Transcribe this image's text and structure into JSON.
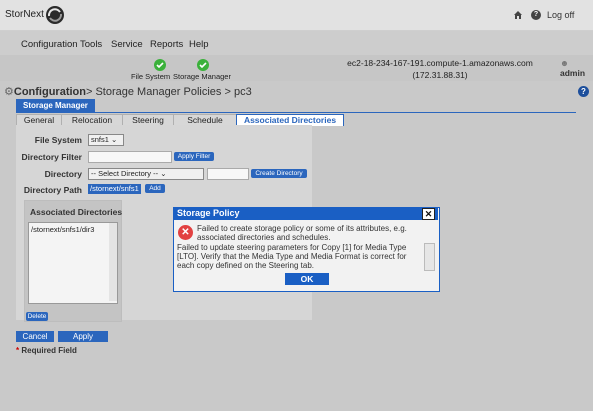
{
  "app": {
    "name": "StorNext",
    "logout_label": "Log off"
  },
  "menu": [
    "Configuration",
    "Tools",
    "Service",
    "Reports",
    "Help"
  ],
  "status": {
    "file_system_label": "File System",
    "storage_manager_label": "Storage Manager",
    "host_name": "ec2-18-234-167-191.compute-1.amazonaws.com",
    "host_ip": "(172.31.88.31)",
    "user": "admin"
  },
  "breadcrumb": {
    "section": "Configuration",
    "path": "> Storage Manager Policies > pc3"
  },
  "section_tab": "Storage Manager",
  "tabs": [
    "General",
    "Relocation",
    "Steering",
    "Schedule",
    "Associated Directories"
  ],
  "form": {
    "file_system_label": "File System",
    "file_system_value": "snfs1",
    "directory_filter_label": "Directory Filter",
    "apply_filter_label": "Apply Filter",
    "directory_label": "Directory",
    "directory_select_value": "-- Select Directory --",
    "create_directory_label": "Create Directory",
    "directory_path_label": "Directory Path",
    "directory_path_value": "/stornext/snfs1",
    "add_label": "Add"
  },
  "associated": {
    "title": "Associated Directories",
    "items": [
      "/stornext/snfs1/dir3"
    ],
    "delete_label": "Delete"
  },
  "footer": {
    "cancel_label": "Cancel",
    "apply_label": "Apply",
    "required_label": "Required Field"
  },
  "dialog": {
    "title": "Storage Policy",
    "message1": "Failed to create storage policy or some of its attributes, e.g. associated directories and schedules.",
    "message2": "Failed to update steering parameters for Copy [1] for Media Type [LTO]. Verify that the Media Type and Media Format is correct for each copy defined on the Steering tab.",
    "ok_label": "OK"
  },
  "colors": {
    "accent": "#2b66bd",
    "dialog_accent": "#1a5fc4",
    "error": "#e24141",
    "ok_check": "#3bb13b"
  }
}
